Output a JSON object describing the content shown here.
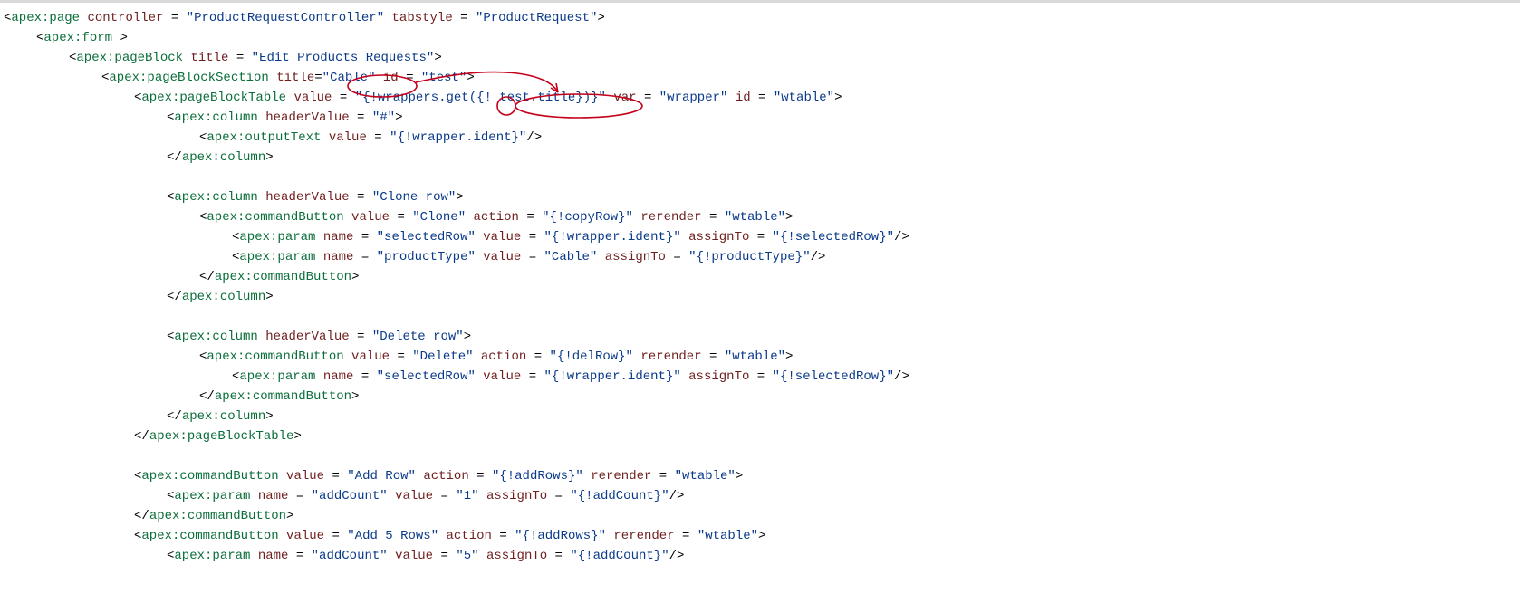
{
  "code": {
    "line01": {
      "el": "apex:page",
      "attrs": [
        [
          "controller",
          "ProductRequestController"
        ],
        [
          "tabstyle",
          "ProductRequest"
        ]
      ]
    },
    "line02": {
      "el": "apex:form"
    },
    "line03": {
      "el": "apex:pageBlock",
      "attrs": [
        [
          "title",
          "Edit Products Requests"
        ]
      ]
    },
    "line04": {
      "el": "apex:pageBlockSection",
      "attrs": [
        [
          "title",
          "Cable"
        ],
        [
          "id",
          "test"
        ]
      ]
    },
    "line05": {
      "el": "apex:pageBlockTable",
      "attrs": [
        [
          "value",
          "{!wrappers.get({! test.title})}"
        ],
        [
          "var",
          "wrapper"
        ],
        [
          "id",
          "wtable"
        ]
      ]
    },
    "line06": {
      "el": "apex:column",
      "attrs": [
        [
          "headerValue",
          "#"
        ]
      ]
    },
    "line07": {
      "el": "apex:outputText",
      "attrs": [
        [
          "value",
          "{!wrapper.ident}"
        ]
      ]
    },
    "line08": {
      "close": "apex:column"
    },
    "line09": {
      "el": "apex:column",
      "attrs": [
        [
          "headerValue",
          "Clone row"
        ]
      ]
    },
    "line10": {
      "el": "apex:commandButton",
      "attrs": [
        [
          "value",
          "Clone"
        ],
        [
          "action",
          "{!copyRow}"
        ],
        [
          "rerender",
          "wtable"
        ]
      ]
    },
    "line11": {
      "el": "apex:param",
      "attrs": [
        [
          "name",
          "selectedRow"
        ],
        [
          "value",
          "{!wrapper.ident}"
        ],
        [
          "assignTo",
          "{!selectedRow}"
        ]
      ]
    },
    "line12": {
      "el": "apex:param",
      "attrs": [
        [
          "name",
          "productType"
        ],
        [
          "value",
          "Cable"
        ],
        [
          "assignTo",
          "{!productType}"
        ]
      ]
    },
    "line13": {
      "close": "apex:commandButton"
    },
    "line14": {
      "close": "apex:column"
    },
    "line15": {
      "el": "apex:column",
      "attrs": [
        [
          "headerValue",
          "Delete row"
        ]
      ]
    },
    "line16": {
      "el": "apex:commandButton",
      "attrs": [
        [
          "value",
          "Delete"
        ],
        [
          "action",
          "{!delRow}"
        ],
        [
          "rerender",
          "wtable"
        ]
      ]
    },
    "line17": {
      "el": "apex:param",
      "attrs": [
        [
          "name",
          "selectedRow"
        ],
        [
          "value",
          "{!wrapper.ident}"
        ],
        [
          "assignTo",
          "{!selectedRow}"
        ]
      ]
    },
    "line18": {
      "close": "apex:commandButton"
    },
    "line19": {
      "close": "apex:column"
    },
    "line20": {
      "close": "apex:pageBlockTable"
    },
    "line21": {
      "el": "apex:commandButton",
      "attrs": [
        [
          "value",
          "Add Row"
        ],
        [
          "action",
          "{!addRows}"
        ],
        [
          "rerender",
          "wtable"
        ]
      ]
    },
    "line22": {
      "el": "apex:param",
      "attrs": [
        [
          "name",
          "addCount"
        ],
        [
          "value",
          "1"
        ],
        [
          "assignTo",
          "{!addCount}"
        ]
      ]
    },
    "line23": {
      "close": "apex:commandButton"
    },
    "line24": {
      "el": "apex:commandButton",
      "attrs": [
        [
          "value",
          "Add 5 Rows"
        ],
        [
          "action",
          "{!addRows}"
        ],
        [
          "rerender",
          "wtable"
        ]
      ]
    },
    "line25": {
      "el": "apex:param",
      "attrs": [
        [
          "name",
          "addCount"
        ],
        [
          "value",
          "5"
        ],
        [
          "assignTo",
          "{!addCount}"
        ]
      ],
      "cut": true
    }
  },
  "annotation": {
    "circle1_target": "\"Cable\"",
    "circle2_target": "{! test.title}",
    "arrow": "from title=\"Cable\" to test.title",
    "color": "#c4001a"
  }
}
